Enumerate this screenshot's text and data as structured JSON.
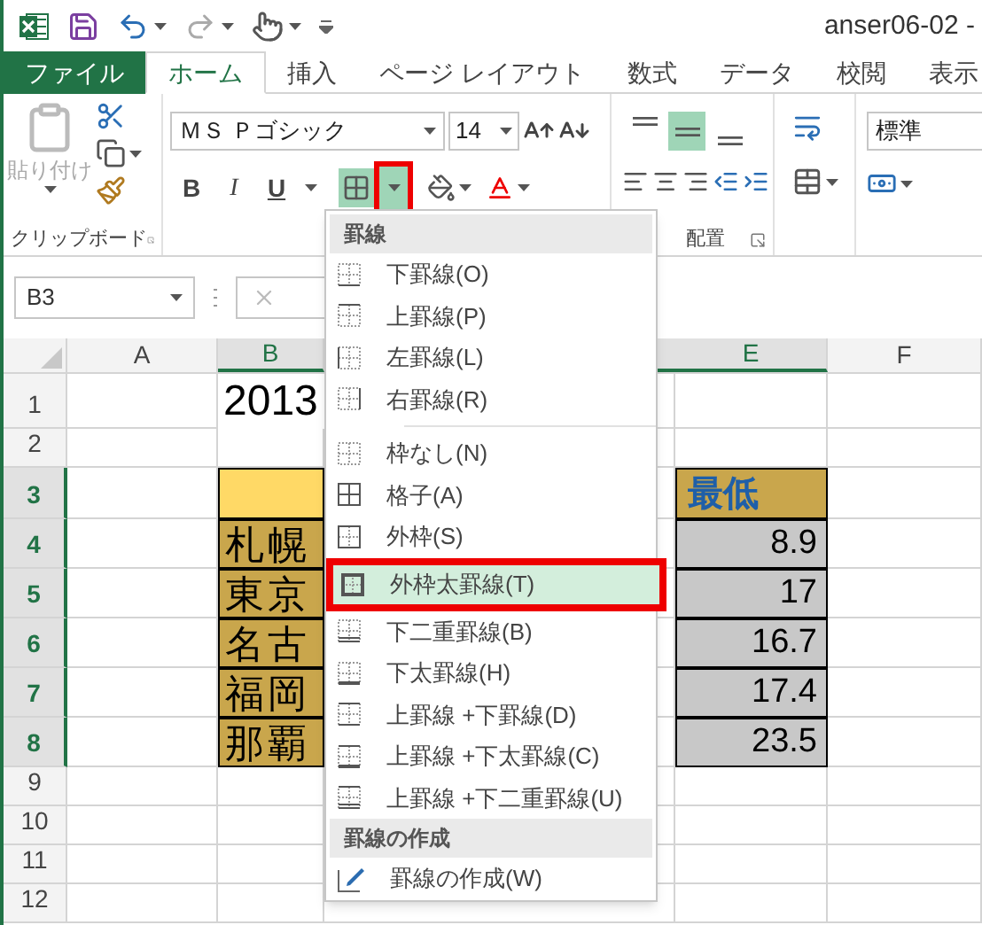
{
  "window": {
    "title": "anser06-02 -"
  },
  "tabs": [
    {
      "label": "ファイル",
      "kind": "file",
      "selected": false
    },
    {
      "label": "ホーム",
      "kind": "tab",
      "selected": true
    },
    {
      "label": "挿入",
      "kind": "tab",
      "selected": false
    },
    {
      "label": "ページ レイアウト",
      "kind": "tab",
      "selected": false
    },
    {
      "label": "数式",
      "kind": "tab",
      "selected": false
    },
    {
      "label": "データ",
      "kind": "tab",
      "selected": false
    },
    {
      "label": "校閲",
      "kind": "tab",
      "selected": false
    },
    {
      "label": "表示",
      "kind": "tab",
      "selected": false
    }
  ],
  "ribbon": {
    "paste": {
      "label": "貼り付け",
      "disabled": true
    },
    "font_name": "ＭＳ Ｐゴシック",
    "font_size": "14",
    "style_buttons": [
      {
        "label": "B",
        "kind": "bold"
      },
      {
        "label": "I",
        "kind": "italic"
      },
      {
        "label": "U",
        "kind": "underline"
      }
    ],
    "borders_dropdown": {
      "callout": true
    },
    "vertical_align": [
      {
        "kind": "top",
        "selected": false
      },
      {
        "kind": "middle",
        "selected": true
      },
      {
        "kind": "bottom",
        "selected": false
      }
    ],
    "number_format": "標準",
    "group_labels": [
      {
        "label": "クリップボード"
      },
      {
        "label": "配置"
      }
    ]
  },
  "name_box": "B3",
  "sheet": {
    "columns": [
      {
        "label": "A",
        "selected": false
      },
      {
        "label": "B",
        "selected": true
      },
      {
        "label": "E",
        "selected": true
      },
      {
        "label": "F",
        "selected": false
      }
    ],
    "rows": [
      {
        "label": "1",
        "selected": false,
        "b": {
          "text": "2013",
          "kind": "title"
        }
      },
      {
        "label": "2",
        "selected": false
      },
      {
        "label": "3",
        "selected": true,
        "b": {
          "kind": "header_light"
        },
        "e": {
          "text": "最低",
          "kind": "header"
        }
      },
      {
        "label": "4",
        "selected": true,
        "b": {
          "text": "札幌",
          "kind": "label"
        },
        "e": {
          "text": "8.9",
          "kind": "value"
        }
      },
      {
        "label": "5",
        "selected": true,
        "b": {
          "text": "東京",
          "kind": "label"
        },
        "e": {
          "text": "17",
          "kind": "value"
        }
      },
      {
        "label": "6",
        "selected": true,
        "b": {
          "text": "名古",
          "kind": "label"
        },
        "e": {
          "text": "16.7",
          "kind": "value"
        }
      },
      {
        "label": "7",
        "selected": true,
        "b": {
          "text": "福岡",
          "kind": "label"
        },
        "e": {
          "text": "17.4",
          "kind": "value"
        }
      },
      {
        "label": "8",
        "selected": true,
        "b": {
          "text": "那覇",
          "kind": "label"
        },
        "e": {
          "text": "23.5",
          "kind": "value"
        }
      },
      {
        "label": "9",
        "selected": false
      },
      {
        "label": "10",
        "selected": false
      },
      {
        "label": "11",
        "selected": false
      },
      {
        "label": "12",
        "selected": false
      }
    ]
  },
  "menu": {
    "sections": [
      {
        "title": "罫線",
        "groups": [
          {
            "items": [
              {
                "label": "下罫線(O)",
                "kind": "bottom",
                "selected": false,
                "callout": false
              },
              {
                "label": "上罫線(P)",
                "kind": "top",
                "selected": false,
                "callout": false
              },
              {
                "label": "左罫線(L)",
                "kind": "left",
                "selected": false,
                "callout": false
              },
              {
                "label": "右罫線(R)",
                "kind": "right",
                "selected": false,
                "callout": false
              }
            ]
          },
          {
            "items": [
              {
                "label": "枠なし(N)",
                "kind": "none",
                "selected": false,
                "callout": false
              },
              {
                "label": "格子(A)",
                "kind": "all",
                "selected": false,
                "callout": false
              },
              {
                "label": "外枠(S)",
                "kind": "outside",
                "selected": false,
                "callout": false
              },
              {
                "label": "外枠太罫線(T)",
                "kind": "thick_outside",
                "selected": true,
                "callout": true
              },
              {
                "label": "下二重罫線(B)",
                "kind": "double_bottom",
                "selected": false,
                "callout": false
              },
              {
                "label": "下太罫線(H)",
                "kind": "thick_bottom",
                "selected": false,
                "callout": false
              },
              {
                "label": "上罫線 +下罫線(D)",
                "kind": "top_bottom",
                "selected": false,
                "callout": false
              },
              {
                "label": "上罫線 +下太罫線(C)",
                "kind": "top_thick_bottom",
                "selected": false,
                "callout": false
              },
              {
                "label": "上罫線 +下二重罫線(U)",
                "kind": "top_double_bottom",
                "selected": false,
                "callout": false
              }
            ]
          }
        ]
      },
      {
        "title": "罫線の作成",
        "groups": [
          {
            "items": [
              {
                "label": "罫線の作成(W)",
                "kind": "draw",
                "selected": false,
                "callout": false
              }
            ]
          }
        ]
      }
    ]
  }
}
